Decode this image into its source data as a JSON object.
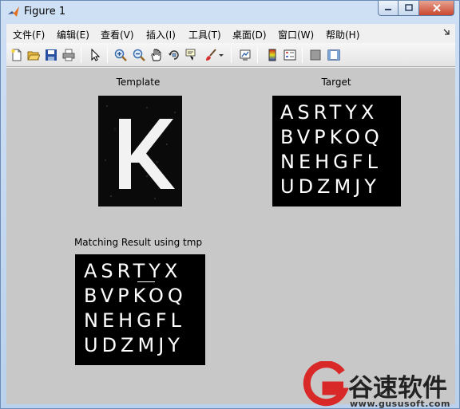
{
  "window": {
    "title": "Figure 1"
  },
  "menu": [
    "文件(F)",
    "编辑(E)",
    "查看(V)",
    "插入(I)",
    "工具(T)",
    "桌面(D)",
    "窗口(W)",
    "帮助(H)"
  ],
  "toolbar": {
    "icons": [
      "new-figure-icon",
      "open-file-icon",
      "save-icon",
      "print-icon",
      "pointer-icon",
      "zoom-in-icon",
      "zoom-out-icon",
      "pan-hand-icon",
      "rotate-3d-icon",
      "data-cursor-icon",
      "brush-icon",
      "link-plot-icon",
      "colorbar-icon",
      "legend-icon",
      "hide-plot-tools-icon",
      "show-plot-tools-icon"
    ]
  },
  "axes": {
    "template": {
      "title": "Template",
      "letter": "K"
    },
    "target": {
      "title": "Target",
      "rows": [
        "ASRTYX",
        "BVPKOQ",
        "NEHGFL",
        "UDZMJY"
      ]
    },
    "result": {
      "title": "Matching Result using tmp",
      "rows": [
        "ASRTYX",
        "BVPKOQ",
        "NEHGFL",
        "UDZMJY"
      ]
    }
  },
  "watermark": {
    "brand": "谷速软件",
    "url": "www.gususoft.com"
  }
}
